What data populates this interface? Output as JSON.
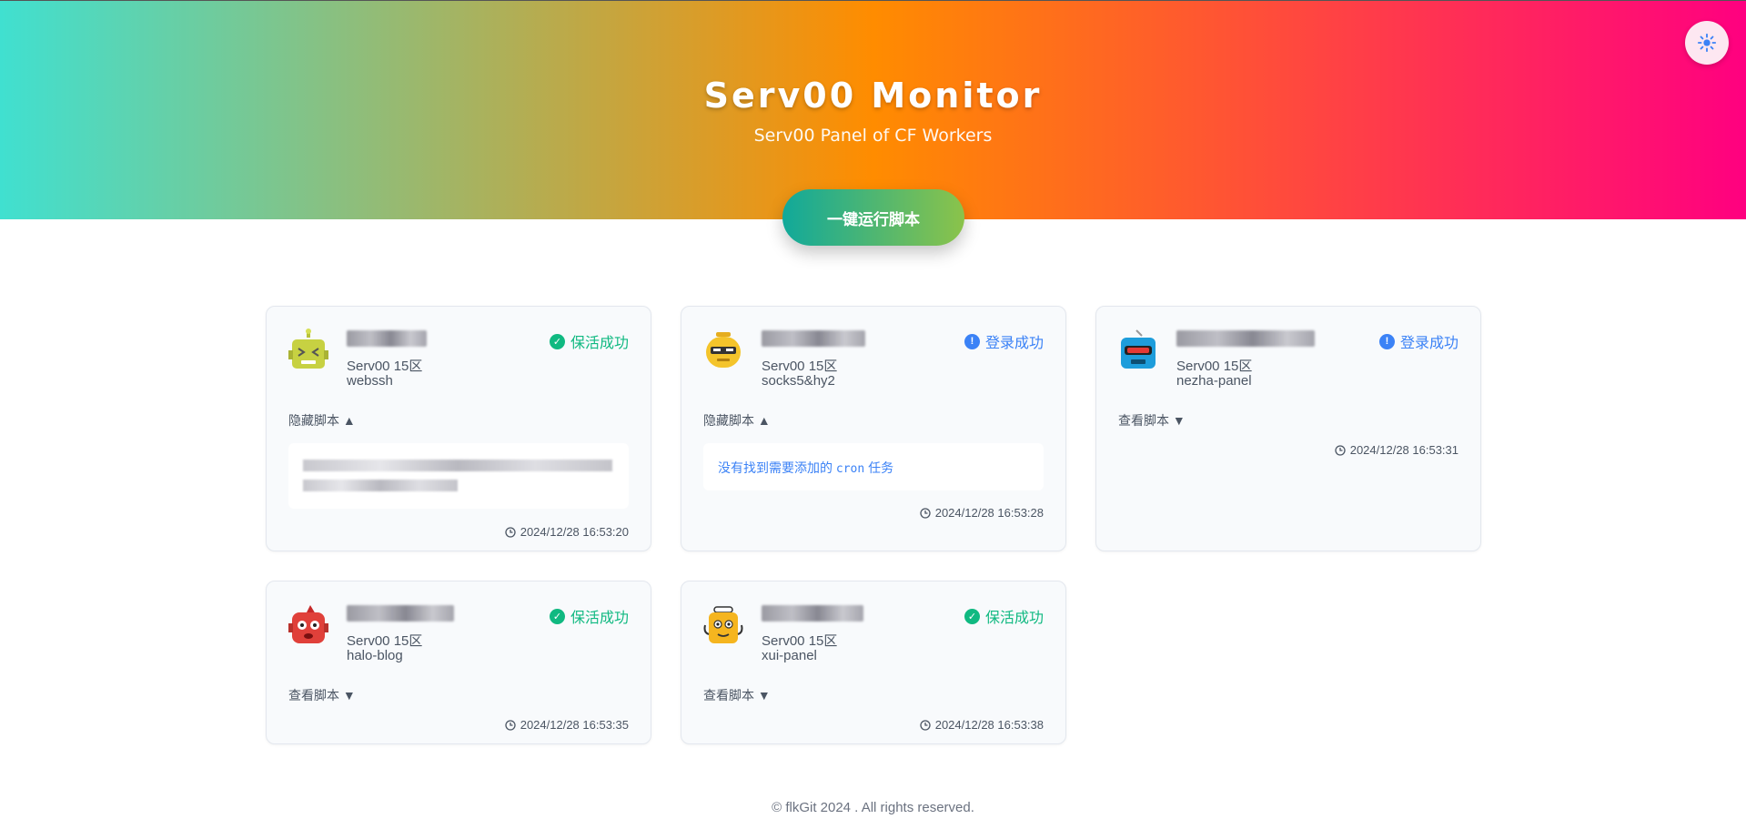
{
  "header": {
    "title": "Serv00 Monitor",
    "subtitle": "Serv00 Panel of CF Workers",
    "theme_icon": "sun-icon",
    "run_button": "一键运行脚本"
  },
  "cards": [
    {
      "server": "Serv00 15区",
      "service": "webssh",
      "status": "保活成功",
      "status_type": "success",
      "toggle": "隐藏脚本 ▲",
      "time": "2024/12/28 16:53:20",
      "avatar_color": "#c7d142"
    },
    {
      "server": "Serv00 15区",
      "service": "socks5&hy2",
      "status": "登录成功",
      "status_type": "info",
      "toggle": "隐藏脚本 ▲",
      "script_msg_pre": "没有找到需要添加的 ",
      "script_msg_code": "cron",
      "script_msg_post": " 任务",
      "time": "2024/12/28 16:53:28",
      "avatar_color": "#f4c42b"
    },
    {
      "server": "Serv00 15区",
      "service": "nezha-panel",
      "status": "登录成功",
      "status_type": "info",
      "toggle": "查看脚本 ▼",
      "time": "2024/12/28 16:53:31",
      "avatar_color": "#1e9ddb"
    },
    {
      "server": "Serv00 15区",
      "service": "halo-blog",
      "status": "保活成功",
      "status_type": "success",
      "toggle": "查看脚本 ▼",
      "time": "2024/12/28 16:53:35",
      "avatar_color": "#e0403a"
    },
    {
      "server": "Serv00 15区",
      "service": "xui-panel",
      "status": "保活成功",
      "status_type": "success",
      "toggle": "查看脚本 ▼",
      "time": "2024/12/28 16:53:38",
      "avatar_color": "#f5b51f"
    }
  ],
  "colors": {
    "success": "#10b981",
    "info": "#3b82f6",
    "accent_gradient": [
      "#40e0d0",
      "#ff8c00",
      "#ff0080"
    ]
  },
  "footer": {
    "text": "© flkGit 2024 . All rights reserved."
  }
}
